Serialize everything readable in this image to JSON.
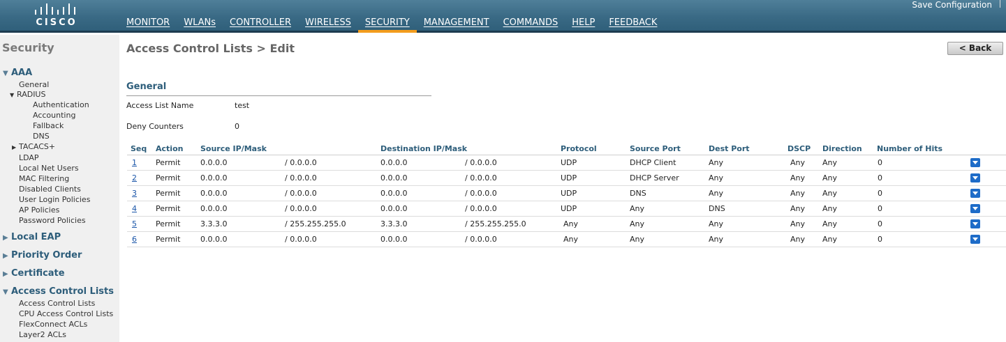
{
  "header": {
    "logo_text": "CISCO",
    "save_configuration": "Save Configuration",
    "nav": [
      {
        "label": "MONITOR"
      },
      {
        "label": "WLANs"
      },
      {
        "label": "CONTROLLER"
      },
      {
        "label": "WIRELESS"
      },
      {
        "label": "SECURITY",
        "active": true
      },
      {
        "label": "MANAGEMENT"
      },
      {
        "label": "COMMANDS"
      },
      {
        "label": "HELP"
      },
      {
        "label": "FEEDBACK"
      }
    ],
    "accent_color": "#f39c1d"
  },
  "sidebar": {
    "title": "Security",
    "aaa": {
      "label": "AAA",
      "general": "General",
      "radius": "RADIUS",
      "radius_items": [
        "Authentication",
        "Accounting",
        "Fallback",
        "DNS"
      ],
      "tacacs": "TACACS+",
      "items": [
        "LDAP",
        "Local Net Users",
        "MAC Filtering",
        "Disabled Clients",
        "User Login Policies",
        "AP Policies",
        "Password Policies"
      ]
    },
    "local_eap": "Local EAP",
    "priority_order": "Priority Order",
    "certificate": "Certificate",
    "acl": {
      "label": "Access Control Lists",
      "items": [
        "Access Control Lists",
        "CPU Access Control Lists",
        "FlexConnect ACLs",
        "Layer2 ACLs"
      ]
    }
  },
  "main": {
    "page_title": "Access Control Lists > Edit",
    "back_button": "< Back",
    "general_title": "General",
    "access_list_name_label": "Access List Name",
    "access_list_name_value": "test",
    "deny_counters_label": "Deny Counters",
    "deny_counters_value": "0"
  },
  "table": {
    "columns": {
      "seq": "Seq",
      "action": "Action",
      "source": "Source IP/Mask",
      "destination": "Destination IP/Mask",
      "protocol": "Protocol",
      "source_port": "Source Port",
      "dest_port": "Dest Port",
      "dscp": "DSCP",
      "direction": "Direction",
      "hits": "Number of Hits"
    },
    "rows": [
      {
        "seq": "1",
        "action": "Permit",
        "src_ip": "0.0.0.0",
        "src_mask": "/ 0.0.0.0",
        "dst_ip": "0.0.0.0",
        "dst_mask": "/ 0.0.0.0",
        "protocol": "UDP",
        "src_port": "DHCP Client",
        "dst_port": "Any",
        "dscp": "Any",
        "direction": "Any",
        "hits": "0"
      },
      {
        "seq": "2",
        "action": "Permit",
        "src_ip": "0.0.0.0",
        "src_mask": "/ 0.0.0.0",
        "dst_ip": "0.0.0.0",
        "dst_mask": "/ 0.0.0.0",
        "protocol": "UDP",
        "src_port": "DHCP Server",
        "dst_port": "Any",
        "dscp": "Any",
        "direction": "Any",
        "hits": "0"
      },
      {
        "seq": "3",
        "action": "Permit",
        "src_ip": "0.0.0.0",
        "src_mask": "/ 0.0.0.0",
        "dst_ip": "0.0.0.0",
        "dst_mask": "/ 0.0.0.0",
        "protocol": "UDP",
        "src_port": "DNS",
        "dst_port": "Any",
        "dscp": "Any",
        "direction": "Any",
        "hits": "0"
      },
      {
        "seq": "4",
        "action": "Permit",
        "src_ip": "0.0.0.0",
        "src_mask": "/ 0.0.0.0",
        "dst_ip": "0.0.0.0",
        "dst_mask": "/ 0.0.0.0",
        "protocol": "UDP",
        "src_port": "Any",
        "dst_port": "DNS",
        "dscp": "Any",
        "direction": "Any",
        "hits": "0"
      },
      {
        "seq": "5",
        "action": "Permit",
        "src_ip": "3.3.3.0",
        "src_mask": "/ 255.255.255.0",
        "dst_ip": "3.3.3.0",
        "dst_mask": "/ 255.255.255.0",
        "protocol": "Any",
        "src_port": "Any",
        "dst_port": "Any",
        "dscp": "Any",
        "direction": "Any",
        "hits": "0"
      },
      {
        "seq": "6",
        "action": "Permit",
        "src_ip": "0.0.0.0",
        "src_mask": "/ 0.0.0.0",
        "dst_ip": "0.0.0.0",
        "dst_mask": "/ 0.0.0.0",
        "protocol": "Any",
        "src_port": "Any",
        "dst_port": "Any",
        "dscp": "Any",
        "direction": "Any",
        "hits": "0"
      }
    ]
  }
}
